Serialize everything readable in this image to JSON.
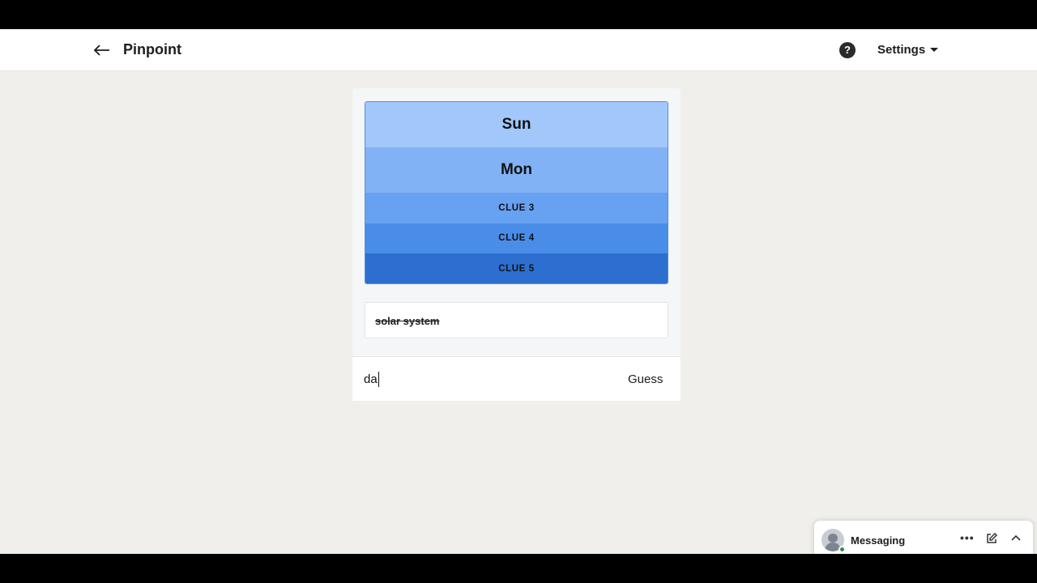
{
  "header": {
    "title": "Pinpoint",
    "settings_label": "Settings",
    "help_glyph": "?",
    "icons": {
      "back": "arrow-left-icon",
      "help": "question-circle-icon",
      "settings_caret": "caret-down-icon"
    }
  },
  "clues": [
    {
      "label": "Sun",
      "revealed": true,
      "color": "#a1c7fb"
    },
    {
      "label": "Mon",
      "revealed": true,
      "color": "#82b2f6"
    },
    {
      "label": "CLUE 3",
      "revealed": false,
      "color": "#67a1f1"
    },
    {
      "label": "CLUE 4",
      "revealed": false,
      "color": "#4a8de8"
    },
    {
      "label": "CLUE 5",
      "revealed": false,
      "color": "#2c6fd1"
    }
  ],
  "previous_guesses": [
    {
      "text": "solar system",
      "correct": false
    }
  ],
  "guess": {
    "value": "da",
    "button_label": "Guess"
  },
  "messaging": {
    "label": "Messaging",
    "more_glyph": "•••",
    "status": "online",
    "icons": {
      "more": "ellipsis-icon",
      "compose": "compose-icon",
      "collapse": "chevron-up-icon"
    }
  },
  "colors": {
    "page_background": "#f0efeb",
    "card_background": "#f5f6f8",
    "online_indicator": "#2d8a4e"
  }
}
